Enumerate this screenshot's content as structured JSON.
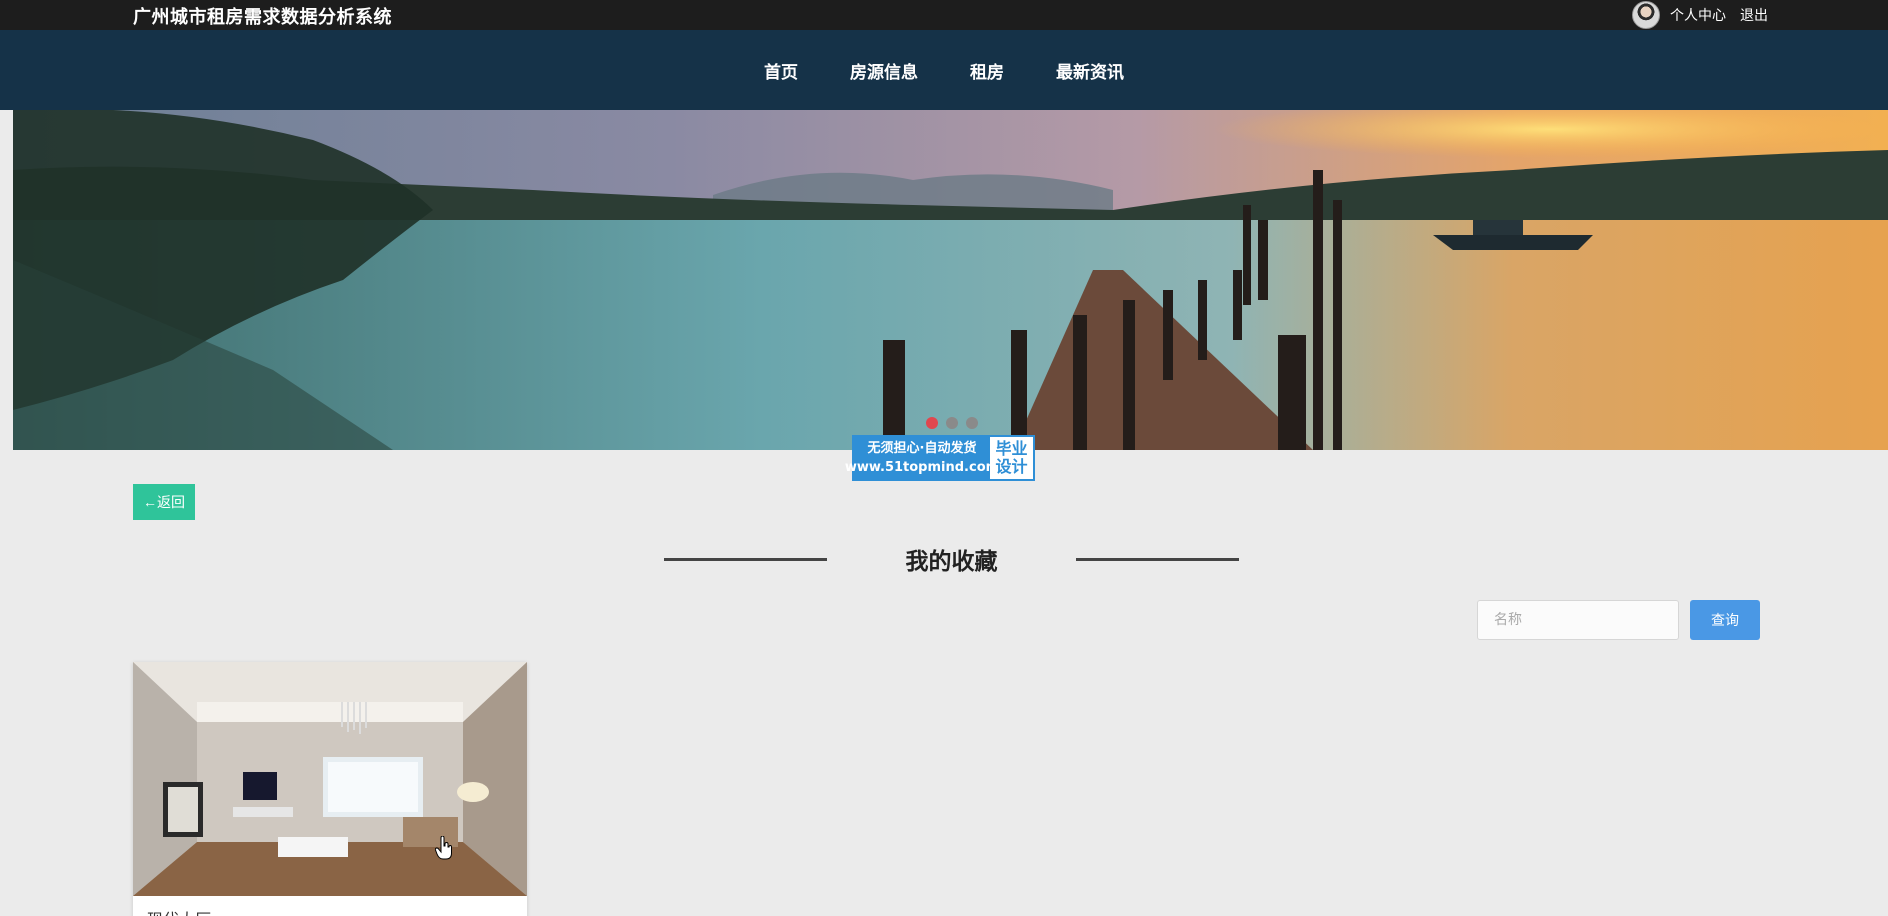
{
  "header": {
    "site_title": "广州城市租房需求数据分析系统",
    "user_center": "个人中心",
    "logout": "退出"
  },
  "nav": {
    "items": [
      {
        "label": "首页"
      },
      {
        "label": "房源信息"
      },
      {
        "label": "租房"
      },
      {
        "label": "最新资讯"
      }
    ]
  },
  "banner": {
    "dot_count": 3,
    "active_dot": 1
  },
  "watermark": {
    "line1": "无须担心·自动发货",
    "line2": "www.51topmind.com",
    "badge_line1": "毕业",
    "badge_line2": "设计"
  },
  "page": {
    "back_label": "←返回",
    "title": "我的收藏"
  },
  "search": {
    "placeholder": "名称",
    "button_label": "查询"
  },
  "favorites": [
    {
      "title": "现代大厅"
    }
  ],
  "colors": {
    "topbar_bg": "#1d1d1d",
    "nav_bg": "#153248",
    "back_button": "#2fc49a",
    "search_button": "#4a98e5",
    "active_dot": "#e0474f"
  }
}
